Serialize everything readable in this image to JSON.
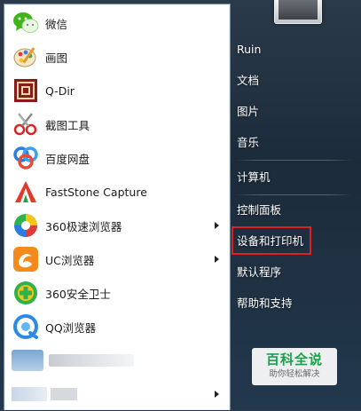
{
  "programs": [
    {
      "label": "微信",
      "icon": "wechat-icon",
      "has_submenu": false
    },
    {
      "label": "画图",
      "icon": "paint-icon",
      "has_submenu": false
    },
    {
      "label": "Q-Dir",
      "icon": "qdir-icon",
      "has_submenu": false
    },
    {
      "label": "截图工具",
      "icon": "snipping-tool-icon",
      "has_submenu": false
    },
    {
      "label": "百度网盘",
      "icon": "baidu-netdisk-icon",
      "has_submenu": false
    },
    {
      "label": "FastStone Capture",
      "icon": "faststone-capture-icon",
      "has_submenu": false
    },
    {
      "label": "360极速浏览器",
      "icon": "360-browser-icon",
      "has_submenu": true
    },
    {
      "label": "UC浏览器",
      "icon": "uc-browser-icon",
      "has_submenu": true
    },
    {
      "label": "360安全卫士",
      "icon": "360-safe-icon",
      "has_submenu": false
    },
    {
      "label": "QQ浏览器",
      "icon": "qq-browser-icon",
      "has_submenu": false
    }
  ],
  "right_links": {
    "user": "Ruin",
    "documents": "文档",
    "pictures": "图片",
    "music": "音乐",
    "computer": "计算机",
    "control_panel": "控制面板",
    "devices_printers": "设备和打印机",
    "default_programs": "默认程序",
    "help_support": "帮助和支持"
  },
  "watermark": {
    "title": "百科全说",
    "subtitle": "助你轻松解决"
  },
  "colors": {
    "highlight": "#e02020",
    "watermark_green": "#17a34a"
  }
}
